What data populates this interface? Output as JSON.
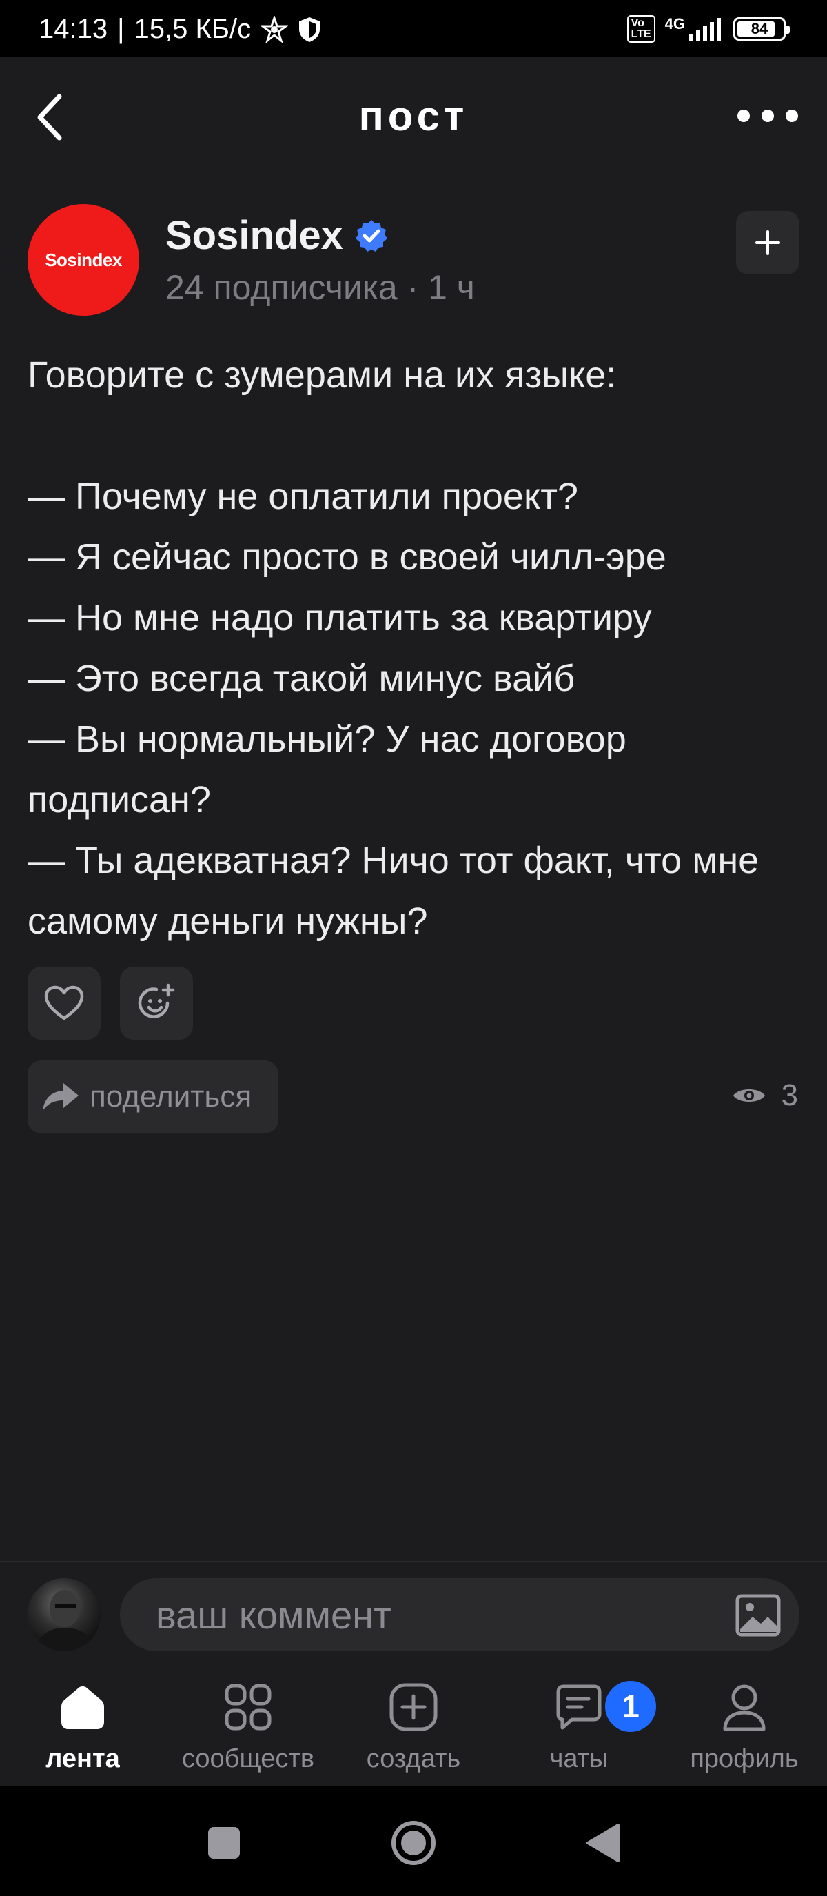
{
  "status_bar": {
    "time": "14:13",
    "separator": "|",
    "speed": "15,5 КБ/с",
    "network": "4G",
    "volte": "VoLTE",
    "battery": "84",
    "battery_level": 0.84
  },
  "header": {
    "back_icon": "chevron-left-icon",
    "title": "пост",
    "more_icon": "more-horizontal-icon"
  },
  "author": {
    "avatar_text": "Sosindex",
    "name": "Sosindex",
    "subscribers": "24 подписчика",
    "meta_separator": " · ",
    "time_ago": "1 ч",
    "follow_icon": "plus-icon",
    "brand_color": "#ef1a1a",
    "verified_color": "#3f7bff"
  },
  "post": {
    "text": "Говорите с зумерами на их языке:\n\n— Почему не оплатили проект?\n— Я сейчас просто в своей чилл-эре\n— Но мне надо платить за квартиру\n— Это всегда такой минус вайб\n— Вы нормальный? У нас договор подписан?\n— Ты адекватная? Ничо тот факт, что мне самому деньги нужны?"
  },
  "actions": {
    "like_icon": "heart-icon",
    "reaction_icon": "add-emoji-icon",
    "share_label": "поделиться",
    "share_icon": "share-arrow-icon",
    "views_icon": "eye-icon",
    "views_count": "3"
  },
  "comment": {
    "placeholder": "ваш коммент",
    "image_icon": "image-icon"
  },
  "nav": {
    "items": [
      {
        "label": "лента",
        "icon": "home-icon"
      },
      {
        "label": "сообществ",
        "icon": "grid-icon"
      },
      {
        "label": "создать",
        "icon": "plus-square-icon"
      },
      {
        "label": "чаты",
        "icon": "chat-icon",
        "badge": "1"
      },
      {
        "label": "профиль",
        "icon": "user-icon"
      }
    ],
    "accent": "#1f6bff"
  }
}
